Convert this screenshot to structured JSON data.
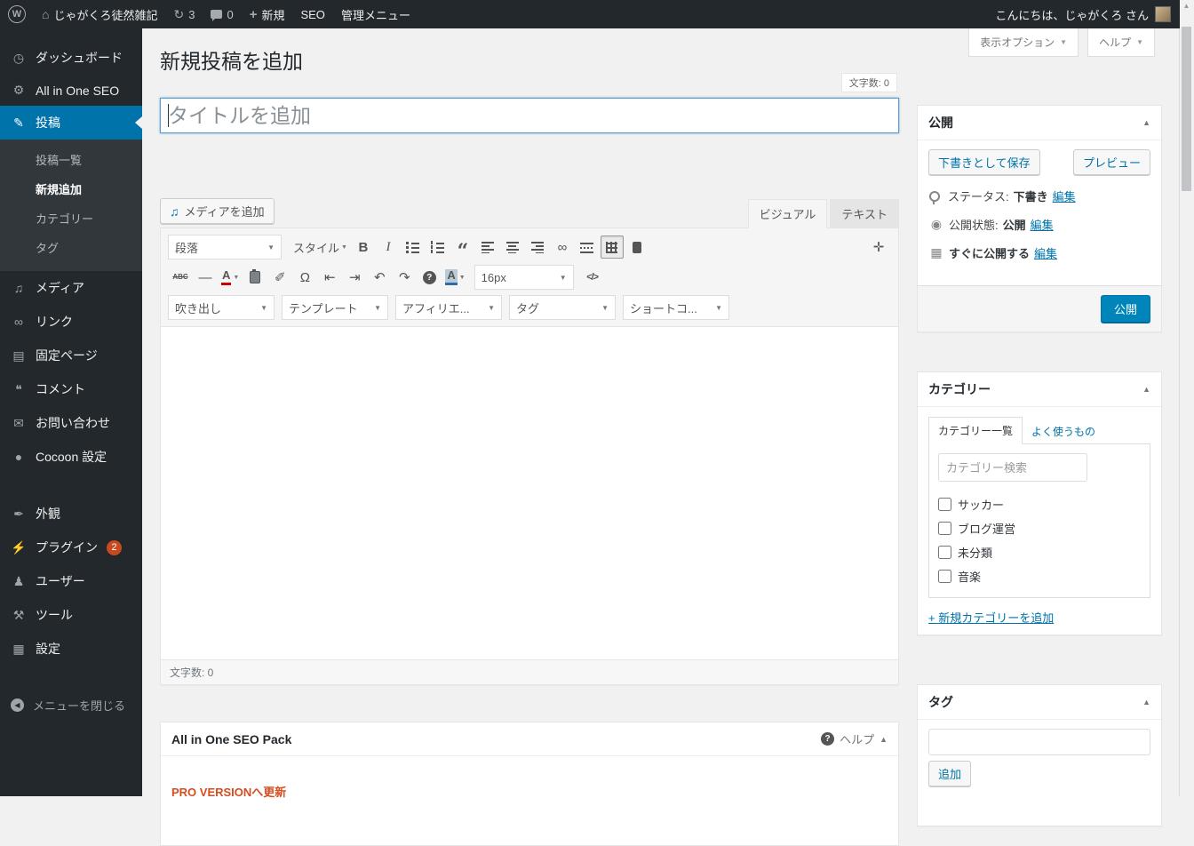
{
  "icons": {
    "caret_down": "▼",
    "caret_up": "▲",
    "plus": "+",
    "home": "⌂",
    "update": "↻",
    "wp": "W",
    "question": "?",
    "scroll_up": "▲",
    "eye": "◉",
    "calendar": "▦",
    "media": "♫"
  },
  "admin_bar": {
    "site_name": "じゃがくろ徒然雑記",
    "updates_count": "3",
    "comments_count": "0",
    "new_label": "新規",
    "seo_label": "SEO",
    "menu_label": "管理メニュー",
    "greeting": "こんにちは、じゃがくろ さん"
  },
  "sidebar": {
    "items": [
      {
        "label": "ダッシュボード",
        "icon": "dashboard-icon",
        "glyph": "◷"
      },
      {
        "label": "All in One SEO",
        "icon": "gear-icon",
        "glyph": "⚙"
      },
      {
        "label": "投稿",
        "icon": "pushpin-icon",
        "glyph": "✎",
        "active": true
      },
      {
        "label": "メディア",
        "icon": "media-icon",
        "glyph": "♫"
      },
      {
        "label": "リンク",
        "icon": "link-icon",
        "glyph": "∞"
      },
      {
        "label": "固定ページ",
        "icon": "pages-icon",
        "glyph": "▤"
      },
      {
        "label": "コメント",
        "icon": "comment-icon",
        "glyph": "❝"
      },
      {
        "label": "お問い合わせ",
        "icon": "mail-icon",
        "glyph": "✉"
      },
      {
        "label": "Cocoon 設定",
        "icon": "cocoon-icon",
        "glyph": "●"
      },
      {
        "label": "外観",
        "icon": "appearance-brush-icon",
        "glyph": "✒"
      },
      {
        "label": "プラグイン",
        "icon": "plugin-icon",
        "glyph": "⚡",
        "badge": "2"
      },
      {
        "label": "ユーザー",
        "icon": "users-icon",
        "glyph": "♟"
      },
      {
        "label": "ツール",
        "icon": "tools-icon",
        "glyph": "⚒"
      },
      {
        "label": "設定",
        "icon": "settings-icon",
        "glyph": "▦"
      },
      {
        "label": "メニューを閉じる",
        "icon": "collapse-menu-icon",
        "glyph": "◀"
      }
    ],
    "post_submenu": [
      {
        "label": "投稿一覧"
      },
      {
        "label": "新規追加",
        "current": true
      },
      {
        "label": "カテゴリー"
      },
      {
        "label": "タグ"
      }
    ]
  },
  "screen_tabs": {
    "screen_options": "表示オプション",
    "help": "ヘルプ"
  },
  "editor_page": {
    "title": "新規投稿を追加",
    "char_count_badge": "文字数: 0",
    "title_placeholder": "タイトルを追加",
    "add_media_button": "メディアを追加",
    "tab_visual": "ビジュアル",
    "tab_text": "テキスト",
    "word_count_bar": "文字数: 0"
  },
  "toolbar": {
    "paragraph": "段落",
    "styles": "スタイル",
    "font_size": "16px",
    "row3": [
      "吹き出し",
      "テンプレート",
      "アフィリエ...",
      "タグ",
      "ショートコ..."
    ],
    "glyphs": {
      "bold": "B",
      "italic": "I",
      "blockquote": "“",
      "link": "∞",
      "fullscreen": "✛",
      "strikethrough": "ABC",
      "hr": "—",
      "color_a": "A",
      "eraser": "✐",
      "omega": "Ω",
      "outdent": "⇤",
      "indent": "⇥",
      "undo": "↶",
      "redo": "↷",
      "highlight_a": "A",
      "code": "</>"
    }
  },
  "publish_box": {
    "title": "公開",
    "save_draft": "下書きとして保存",
    "preview": "プレビュー",
    "status_label": "ステータス:",
    "status_value": "下書き",
    "visibility_label": "公開状態:",
    "visibility_value": "公開",
    "schedule_label": "すぐに公開する",
    "edit_link": "編集",
    "publish_button": "公開"
  },
  "categories_box": {
    "title": "カテゴリー",
    "tab_all": "カテゴリー一覧",
    "tab_most_used": "よく使うもの",
    "search_placeholder": "カテゴリー検索",
    "items": [
      "サッカー",
      "ブログ運営",
      "未分類",
      "音楽"
    ],
    "add_new": "+ 新規カテゴリーを追加"
  },
  "tags_box": {
    "title": "タグ",
    "add_button": "追加"
  },
  "seo_box": {
    "title": "All in One SEO Pack",
    "help": "ヘルプ",
    "pro_link": "PRO VERSIONへ更新"
  },
  "colors": {
    "accent": "#0073aa",
    "active_menu": "#0073aa",
    "publish_button": "#0085ba",
    "plugin_badge": "#ca4a1f",
    "admin_bar": "#23282d",
    "pro_link_red": "#d54e21",
    "page_background": "#f1f1f1"
  }
}
